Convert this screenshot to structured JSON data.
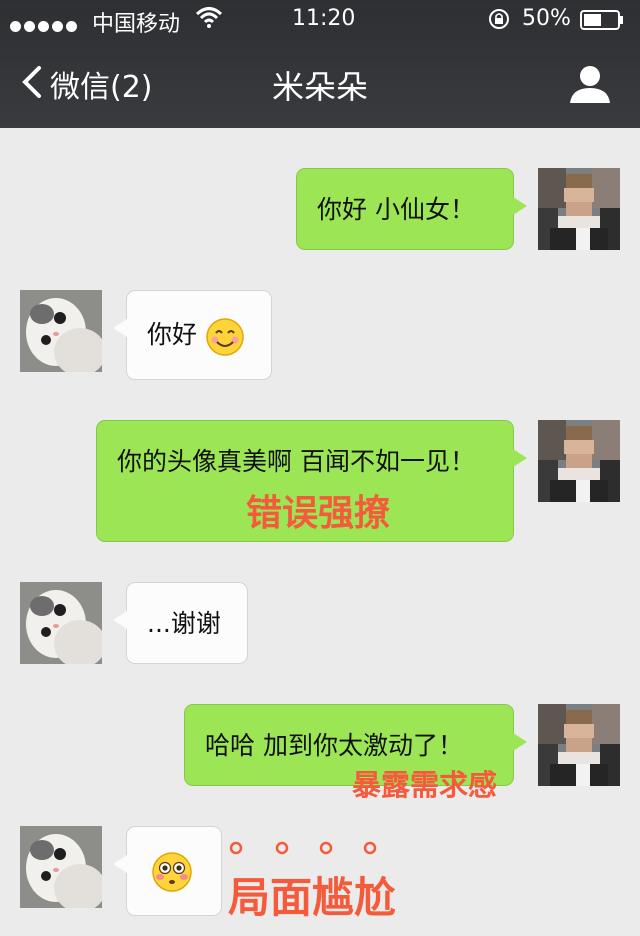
{
  "status_bar": {
    "carrier": "中国移动",
    "time": "11:20",
    "battery": "50%"
  },
  "nav": {
    "back_label": "微信(2)",
    "title": "米朵朵"
  },
  "messages": [
    {
      "from": "me",
      "text": "你好 小仙女！"
    },
    {
      "from": "other",
      "text": "你好",
      "emoji": "smiling-face-emoji"
    },
    {
      "from": "me",
      "text": "你的头像真美啊 百闻不如一见！",
      "annotation": "错误强撩"
    },
    {
      "from": "other",
      "text": "...谢谢"
    },
    {
      "from": "me",
      "text": "哈哈 加到你太激动了！",
      "annotation": "暴露需求感"
    },
    {
      "from": "other",
      "text": "",
      "emoji": "flushed-face-emoji",
      "annotation": "局面尴尬"
    }
  ],
  "colors": {
    "nav_bg": "#36373b",
    "chat_bg": "#ebebeb",
    "bubble_out": "#9ce554",
    "bubble_in": "#fcfcfc",
    "annotation": "#f35b3c"
  }
}
